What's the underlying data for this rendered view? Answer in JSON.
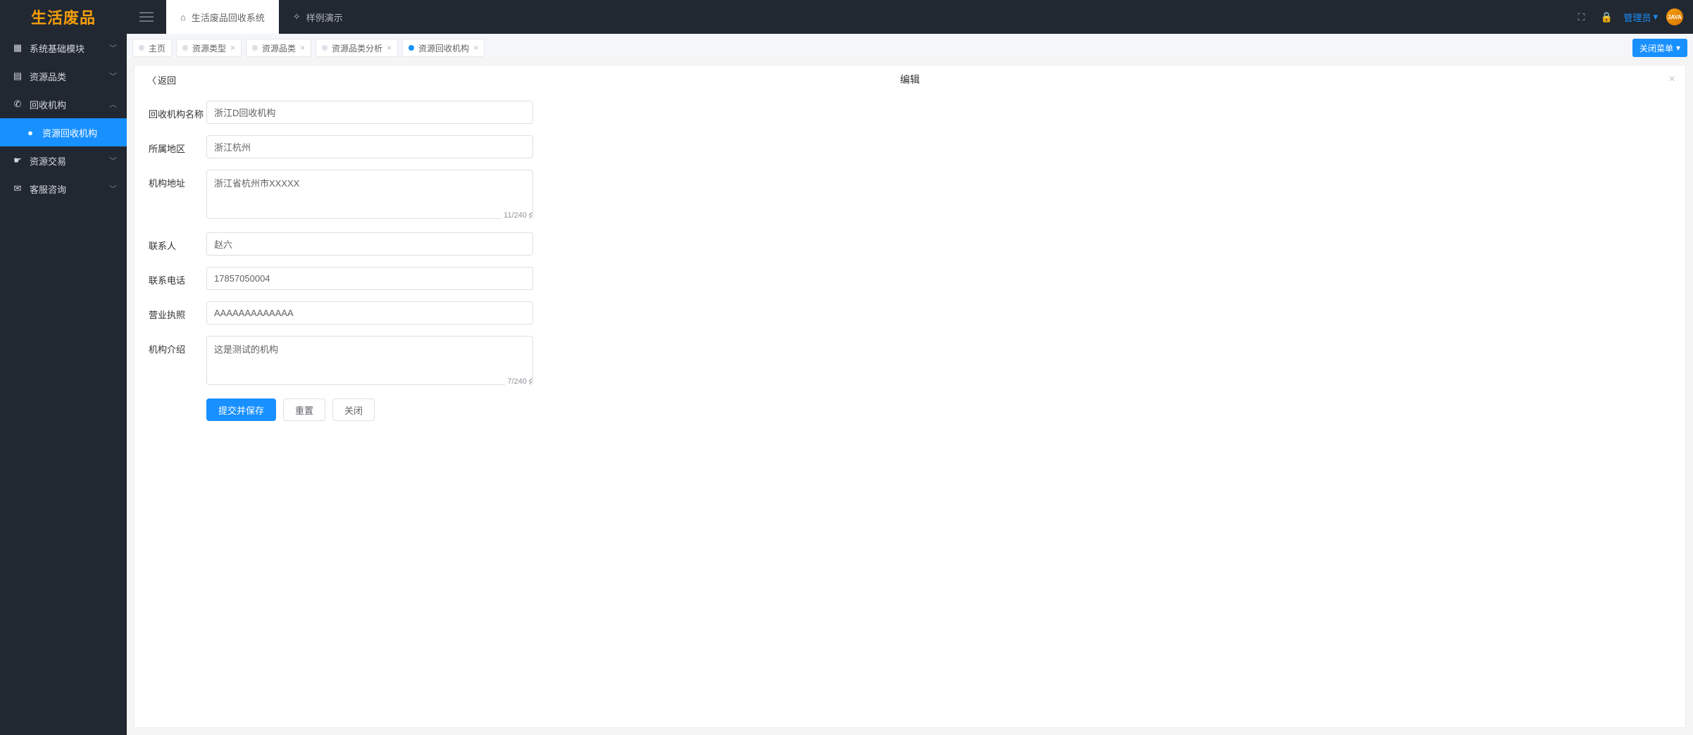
{
  "logo": "生活废品",
  "sidebar": {
    "items": [
      {
        "label": "系统基础模块",
        "icon": "grid",
        "expanded": false,
        "hasChildren": true
      },
      {
        "label": "资源品类",
        "icon": "apps",
        "expanded": false,
        "hasChildren": true
      },
      {
        "label": "回收机构",
        "icon": "phone",
        "expanded": true,
        "hasChildren": true
      },
      {
        "label": "资源回收机构",
        "icon": "dot",
        "sub": true,
        "active": true
      },
      {
        "label": "资源交易",
        "icon": "hand",
        "expanded": false,
        "hasChildren": true
      },
      {
        "label": "客服咨询",
        "icon": "chat",
        "expanded": false,
        "hasChildren": true
      }
    ]
  },
  "header": {
    "tab1": "生活废品回收系统",
    "tab2": "样例演示",
    "user": "管理员",
    "avatar": "JAVA"
  },
  "tabs": [
    {
      "label": "主页",
      "closable": false,
      "active": false
    },
    {
      "label": "资源类型",
      "closable": true,
      "active": false
    },
    {
      "label": "资源品类",
      "closable": true,
      "active": false
    },
    {
      "label": "资源品类分析",
      "closable": true,
      "active": false
    },
    {
      "label": "资源回收机构",
      "closable": true,
      "active": true
    }
  ],
  "closeMenuBtn": "关闭菜单",
  "card": {
    "back": "返回",
    "title": "编辑"
  },
  "form": {
    "fields": {
      "orgName": {
        "label": "回收机构名称",
        "value": "浙江D回收机构"
      },
      "region": {
        "label": "所属地区",
        "value": "浙江杭州"
      },
      "address": {
        "label": "机构地址",
        "value": "浙江省杭州市XXXXX",
        "count": "11/240"
      },
      "contact": {
        "label": "联系人",
        "value": "赵六"
      },
      "phone": {
        "label": "联系电话",
        "value": "17857050004"
      },
      "license": {
        "label": "营业执照",
        "value": "AAAAAAAAAAAAA"
      },
      "intro": {
        "label": "机构介绍",
        "value": "这是测试的机构",
        "count": "7/240"
      }
    },
    "buttons": {
      "submit": "提交并保存",
      "reset": "重置",
      "close": "关闭"
    }
  }
}
